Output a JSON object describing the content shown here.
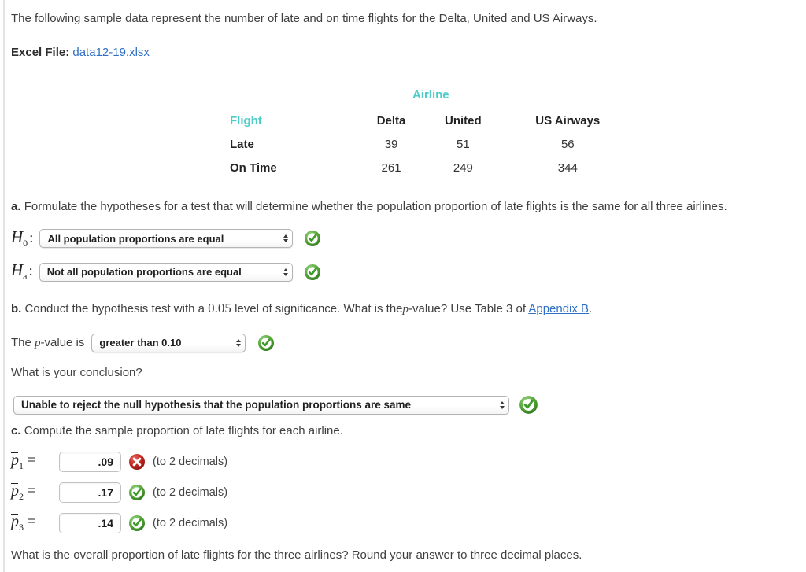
{
  "intro": {
    "description": "The following sample data represent the number of late and on time flights for the Delta, United and US Airways.",
    "excel_label": "Excel File:",
    "excel_file": "data12-19.xlsx"
  },
  "table": {
    "group_header": "Airline",
    "corner_header": "Flight",
    "columns": [
      "Delta",
      "United",
      "US Airways"
    ],
    "rows": [
      {
        "label": "Late",
        "values": [
          "39",
          "51",
          "56"
        ]
      },
      {
        "label": "On Time",
        "values": [
          "261",
          "249",
          "344"
        ]
      }
    ]
  },
  "part_a": {
    "prompt": "Formulate the hypotheses for a test that will determine whether the population proportion of late flights is the same for all three airlines.",
    "letter": "a.",
    "h0_symbol": "H",
    "h0_sub": "0",
    "ha_symbol": "H",
    "ha_sub": "a",
    "colon": ":",
    "h0_value": "All population proportions are equal",
    "ha_value": "Not all population proportions are equal",
    "h0_status": "correct",
    "ha_status": "correct"
  },
  "part_b": {
    "letter": "b.",
    "prompt_1": "Conduct the hypothesis test with a",
    "alpha": "0.05",
    "prompt_2": "level of significance. What is the",
    "p_italic": "p",
    "prompt_3": "-value? Use Table 3 of",
    "appendix_link": "Appendix B",
    "prompt_4": ".",
    "pvalue_label_1": "The",
    "pvalue_label_2": "-value is",
    "pvalue_value": "greater than 0.10",
    "pvalue_status": "correct",
    "conclusion_question": "What is your conclusion?",
    "conclusion_value": "Unable to reject the null hypothesis that the population proportions are same",
    "conclusion_status": "correct"
  },
  "part_c": {
    "letter": "c.",
    "prompt": "Compute the sample proportion of late flights for each airline.",
    "proportions": [
      {
        "symbol": "p",
        "sub": "1",
        "value": ".09",
        "hint": "(to 2 decimals)",
        "status": "incorrect"
      },
      {
        "symbol": "p",
        "sub": "2",
        "value": ".17",
        "hint": "(to 2 decimals)",
        "status": "correct"
      },
      {
        "symbol": "p",
        "sub": "3",
        "value": ".14",
        "hint": "(to 2 decimals)",
        "status": "correct"
      }
    ],
    "tail_question": "What is the overall proportion of late flights for the three airlines? Round your answer to three decimal places."
  },
  "colors": {
    "link": "#2f6fc4",
    "teal": "#4ecdc8",
    "correct": "#3f9b29",
    "incorrect": "#c0201c",
    "text": "#3f3f3f"
  }
}
